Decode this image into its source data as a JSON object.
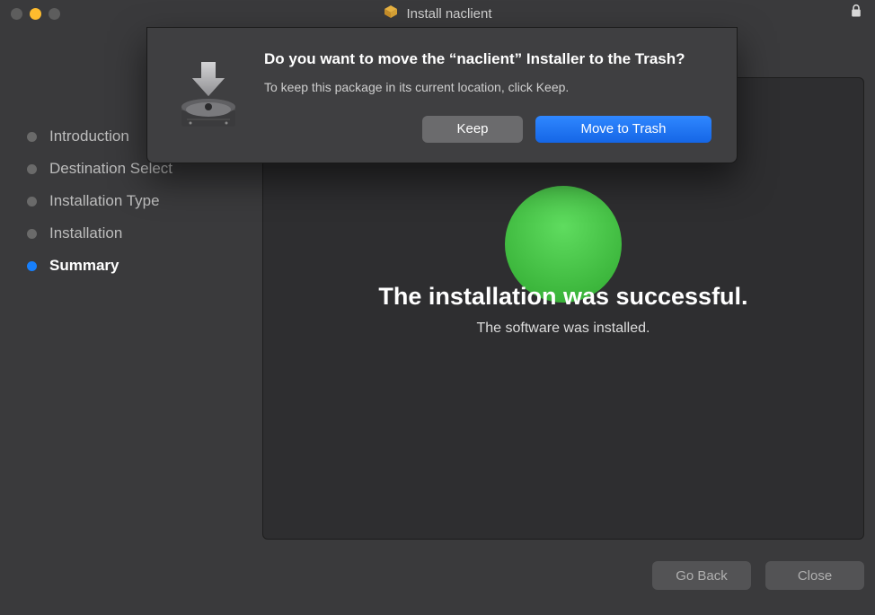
{
  "window": {
    "title": "Install naclient"
  },
  "sidebar": {
    "steps": [
      {
        "label": "Introduction",
        "active": false
      },
      {
        "label": "Destination Select",
        "active": false
      },
      {
        "label": "Installation Type",
        "active": false
      },
      {
        "label": "Installation",
        "active": false
      },
      {
        "label": "Summary",
        "active": true
      }
    ]
  },
  "main": {
    "heading": "The installation was successful.",
    "subtext": "The software was installed."
  },
  "footer": {
    "go_back": "Go Back",
    "close": "Close"
  },
  "dialog": {
    "title": "Do you want to move the “naclient” Installer to the Trash?",
    "body": "To keep this package in its current location, click Keep.",
    "keep_label": "Keep",
    "trash_label": "Move to Trash"
  }
}
